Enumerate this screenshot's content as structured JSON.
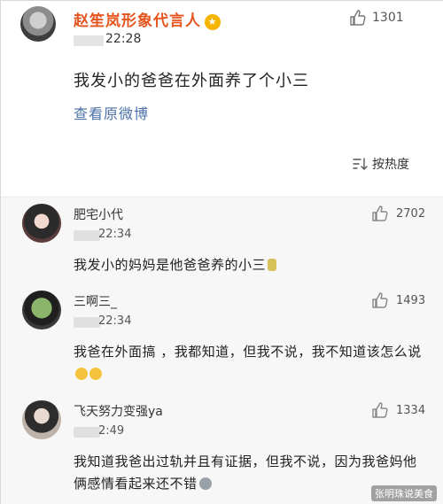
{
  "post": {
    "author": "赵笙岚形象代言人",
    "time": "22:28",
    "content": "我发小的爸爸在外面养了个小三",
    "view_original": "查看原微博",
    "like_count": "1301",
    "sort_label": "按热度"
  },
  "comments": [
    {
      "name": "肥宅小代",
      "time": "22:34",
      "text": "我发小的妈妈是他爸爸养的小三",
      "like_count": "2702"
    },
    {
      "name": "三啊三_",
      "time": "22:34",
      "text": "我爸在外面搞 ，我都知道，但我不说，我不知道该怎么说",
      "like_count": "1493"
    },
    {
      "name": "飞天努力变强ya",
      "time": "2:49",
      "text": "我知道我爸出过轨并且有证据，但我不说，因为我爸妈他俩感情看起来还不错",
      "like_count": "1334"
    }
  ],
  "watermark": "张明珠说美食",
  "icons": {
    "like": "thumbs-up-icon",
    "sort": "sort-icon",
    "badge": "vip-badge-icon"
  },
  "colors": {
    "author_name": "#e5541d",
    "link": "#4b72a8",
    "comment_bg": "#f7f7f7"
  }
}
